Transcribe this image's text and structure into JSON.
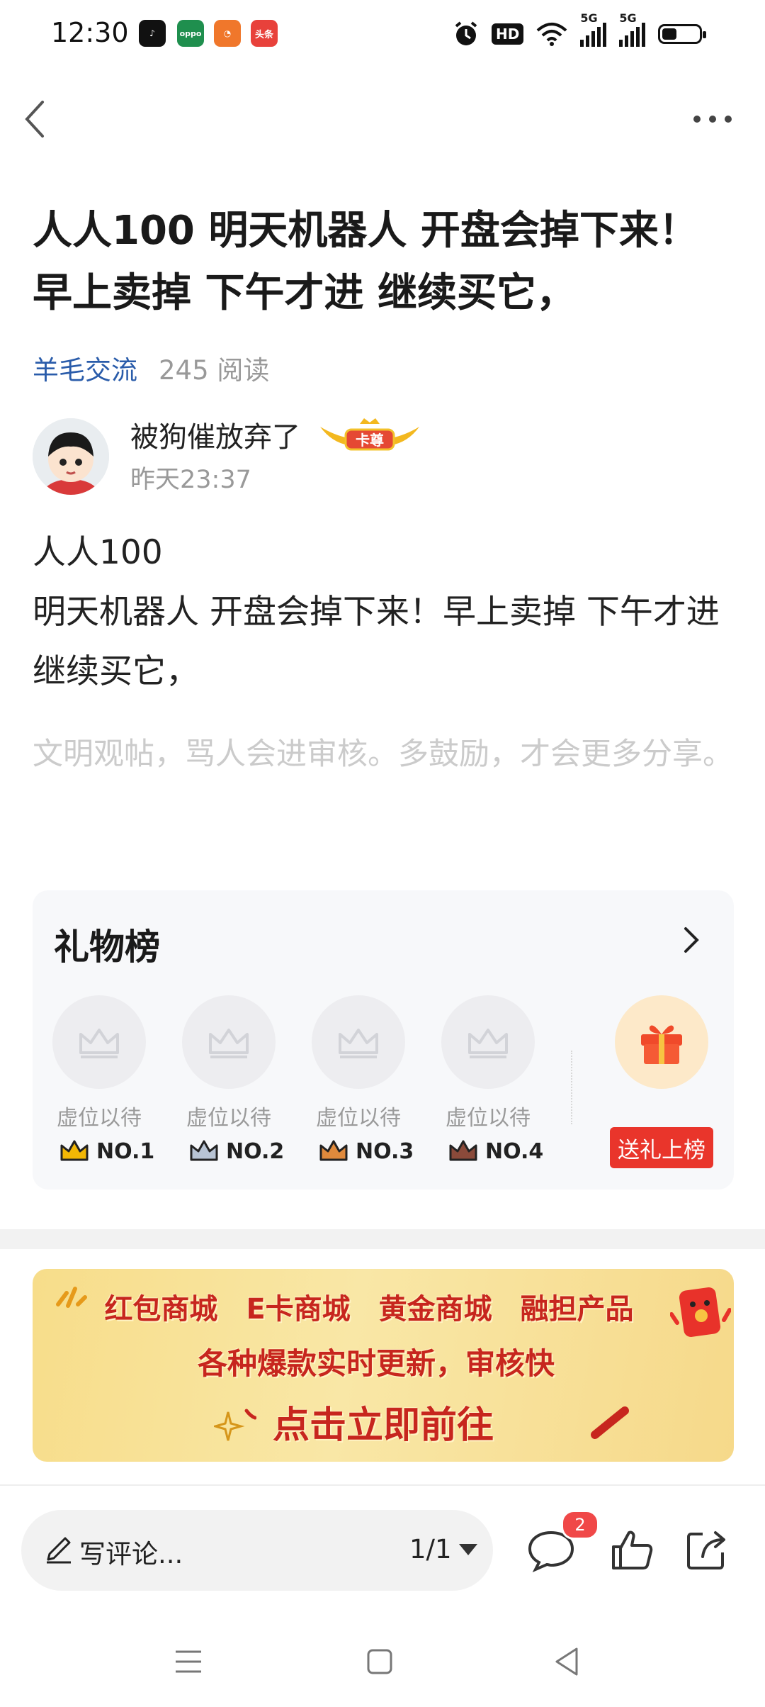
{
  "status_bar": {
    "time": "12:30",
    "app_icons": [
      {
        "name": "douyin-icon",
        "color": "#111111",
        "label": "♪"
      },
      {
        "name": "oppo-icon",
        "color": "#1f8f4e",
        "label": "oppo"
      },
      {
        "name": "orange-app-icon",
        "color": "#f0772b",
        "label": ""
      },
      {
        "name": "toutiao-icon",
        "color": "#e8413b",
        "label": "头条"
      }
    ],
    "hd_label": "HD",
    "network_label": "5G"
  },
  "post": {
    "title": "人人100 明天机器人 开盘会掉下来！早上卖掉 下午才进 继续买它，",
    "category": "羊毛交流",
    "reads": "245 阅读",
    "author": "被狗催放弃了",
    "badge": "卡尊",
    "time": "昨天23:37",
    "body_line1": "人人100",
    "body_line2": "明天机器人 开盘会掉下来！早上卖掉 下午才进 继续买它，",
    "hint": "文明观帖，骂人会进审核。多鼓励，才会更多分享。"
  },
  "gift_board": {
    "title": "礼物榜",
    "slots": [
      {
        "label": "虚位以待",
        "rank": "NO.1",
        "color": "#f2b705"
      },
      {
        "label": "虚位以待",
        "rank": "NO.2",
        "color": "#8a9bb0"
      },
      {
        "label": "虚位以待",
        "rank": "NO.3",
        "color": "#d9772b"
      },
      {
        "label": "虚位以待",
        "rank": "NO.4",
        "color": "#8a4a3a"
      }
    ],
    "send_button": "送礼上榜"
  },
  "banner": {
    "line1": "红包商城 E卡商城 黄金商城 融担产品",
    "line2": "各种爆款实时更新，审核快",
    "line3": "点击立即前往"
  },
  "bottom_bar": {
    "comment_placeholder": "写评论...",
    "page": "1/1",
    "comment_count": "2"
  },
  "colors": {
    "accent_blue": "#2a5caa",
    "red": "#e9352b"
  }
}
